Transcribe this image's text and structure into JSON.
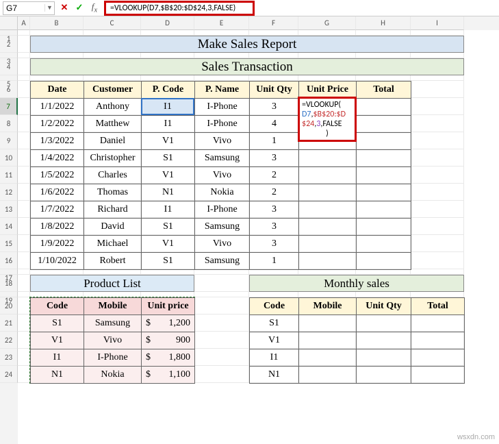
{
  "name_box": "G7",
  "formula": "=VLOOKUP(D7,$B$20:$D$24,3,FALSE)",
  "col_labels": [
    "A",
    "B",
    "C",
    "D",
    "E",
    "F",
    "G",
    "H",
    "I"
  ],
  "title_main": "Make Sales Report",
  "title_sub": "Sales Transaction",
  "sales": {
    "headers": [
      "Date",
      "Customer",
      "P. Code",
      "P. Name",
      "Unit Qty",
      "Unit Price",
      "Total"
    ],
    "rows": [
      {
        "date": "1/1/2022",
        "cust": "Anthony",
        "pcode": "I1",
        "pname": "I-Phone",
        "qty": "3"
      },
      {
        "date": "1/2/2022",
        "cust": "Matthew",
        "pcode": "I1",
        "pname": "I-Phone",
        "qty": "4"
      },
      {
        "date": "1/3/2022",
        "cust": "Daniel",
        "pcode": "V1",
        "pname": "Vivo",
        "qty": "1"
      },
      {
        "date": "1/4/2022",
        "cust": "Christopher",
        "pcode": "S1",
        "pname": "Samsung",
        "qty": "3"
      },
      {
        "date": "1/5/2022",
        "cust": "Charles",
        "pcode": "V1",
        "pname": "Vivo",
        "qty": "2"
      },
      {
        "date": "1/6/2022",
        "cust": "Thomas",
        "pcode": "N1",
        "pname": "Nokia",
        "qty": "2"
      },
      {
        "date": "1/7/2022",
        "cust": "Richard",
        "pcode": "I1",
        "pname": "I-Phone",
        "qty": "3"
      },
      {
        "date": "1/8/2022",
        "cust": "David",
        "pcode": "S1",
        "pname": "Samsung",
        "qty": "3"
      },
      {
        "date": "1/9/2022",
        "cust": "Michael",
        "pcode": "V1",
        "pname": "Vivo",
        "qty": "3"
      },
      {
        "date": "1/10/2022",
        "cust": "Robert",
        "pcode": "S1",
        "pname": "Samsung",
        "qty": "1"
      }
    ]
  },
  "g7_inline": {
    "line1a": "=VLOOKUP(",
    "line2a": "D7",
    "line2b": ",",
    "line2c": "$B$20:$D",
    "line3a": "$24",
    "line3b": ",",
    "line3c": "3",
    "line3d": ",FALSE",
    "line4": ")"
  },
  "product": {
    "title": "Product List",
    "headers": [
      "Code",
      "Mobile",
      "Unit price"
    ],
    "rows": [
      {
        "code": "S1",
        "mobile": "Samsung",
        "cur": "$",
        "price": "1,200"
      },
      {
        "code": "V1",
        "mobile": "Vivo",
        "cur": "$",
        "price": "900"
      },
      {
        "code": "I1",
        "mobile": "I-Phone",
        "cur": "$",
        "price": "1,800"
      },
      {
        "code": "N1",
        "mobile": "Nokia",
        "cur": "$",
        "price": "1,100"
      }
    ]
  },
  "monthly": {
    "title": "Monthly sales",
    "headers": [
      "Code",
      "Mobile",
      "Unit Qty",
      "Total"
    ],
    "rows": [
      {
        "code": "S1"
      },
      {
        "code": "V1"
      },
      {
        "code": "I1"
      },
      {
        "code": "N1"
      }
    ]
  },
  "watermark": "wsxdn.com"
}
